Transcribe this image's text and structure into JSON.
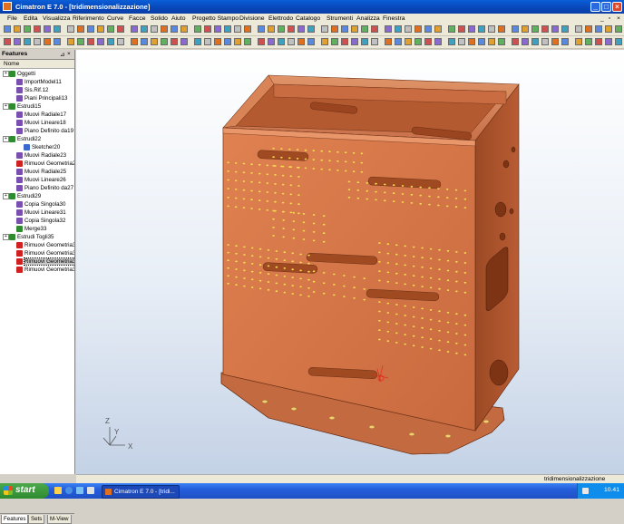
{
  "window": {
    "title": "Cimatron E 7.0 - [tridimensionalizzazione]"
  },
  "menu": [
    "File",
    "Edita",
    "Visualizza",
    "Riferimento",
    "Curve",
    "Facce",
    "Solido",
    "Aiuto",
    "Progetto Stampo",
    "Divisione",
    "Elettrodo",
    "Catalogo",
    "Strumenti",
    "Analizza",
    "Finestra"
  ],
  "panel": {
    "title": "Features",
    "column_header": "Nome",
    "items": [
      {
        "label": "Oggetti",
        "icon": "objects-icon",
        "color": "#2e8b2e"
      },
      {
        "label": "ImportModel11",
        "icon": "import-icon",
        "color": "#7a4fb0"
      },
      {
        "label": "Sis.Rif.12",
        "icon": "ucs-icon",
        "color": "#7a4fb0"
      },
      {
        "label": "Piani Principali13",
        "icon": "planes-icon",
        "color": "#7a4fb0"
      },
      {
        "label": "Estrudi15",
        "icon": "extrude-icon",
        "color": "#2e8b2e"
      },
      {
        "label": "Muovi Radiale17",
        "icon": "move-icon",
        "color": "#7a4fb0"
      },
      {
        "label": "Muovi Lineare18",
        "icon": "move-icon",
        "color": "#7a4fb0"
      },
      {
        "label": "Piano Definito da19",
        "icon": "plane-icon",
        "color": "#7a4fb0"
      },
      {
        "label": "Estrudi22",
        "icon": "extrude-icon",
        "color": "#2e8b2e"
      },
      {
        "label": "Sketcher20",
        "icon": "sketch-icon",
        "color": "#3a6ad0"
      },
      {
        "label": "Muovi Radiale23",
        "icon": "move-icon",
        "color": "#7a4fb0"
      },
      {
        "label": "Rimuovi Geometria2",
        "icon": "remove-icon",
        "color": "#d02020"
      },
      {
        "label": "Muovi Radiale25",
        "icon": "move-icon",
        "color": "#7a4fb0"
      },
      {
        "label": "Muovi Lineare26",
        "icon": "move-icon",
        "color": "#7a4fb0"
      },
      {
        "label": "Piano Definito da27",
        "icon": "plane-icon",
        "color": "#7a4fb0"
      },
      {
        "label": "Estrudi29",
        "icon": "extrude-icon",
        "color": "#2e8b2e"
      },
      {
        "label": "Copia Singola30",
        "icon": "copy-icon",
        "color": "#7a4fb0"
      },
      {
        "label": "Muovi Lineare31",
        "icon": "move-icon",
        "color": "#7a4fb0"
      },
      {
        "label": "Copia Singola32",
        "icon": "copy-icon",
        "color": "#7a4fb0"
      },
      {
        "label": "Merge33",
        "icon": "merge-icon",
        "color": "#2e8b2e"
      },
      {
        "label": "Estrudi Togli35",
        "icon": "extrude-cut-icon",
        "color": "#2e8b2e"
      },
      {
        "label": "Rimuovi Geometria3",
        "icon": "remove-icon",
        "color": "#d02020"
      },
      {
        "label": "Rimuovi Geometria3",
        "icon": "remove-icon",
        "color": "#d02020"
      },
      {
        "label": "Rimuovi Geometria3",
        "icon": "remove-icon",
        "color": "#d02020",
        "selected": true
      },
      {
        "label": "Rimuovi Geometria3",
        "icon": "remove-icon",
        "color": "#d02020"
      }
    ],
    "tabs": [
      "Features",
      "Sets",
      "M-View"
    ]
  },
  "viewport": {
    "axis_labels": {
      "z": "Z",
      "y": "Y",
      "x": "X"
    }
  },
  "status": {
    "text": "tridimensionalizzazione"
  },
  "taskbar": {
    "start": "start",
    "task": "Cimatron E 7.0 - [tridi...",
    "clock": "10.41"
  },
  "colors": {
    "part": "#d2744a",
    "part_dark": "#8a3c1c",
    "holes": "#f4e04c",
    "selection": "#e03020"
  }
}
